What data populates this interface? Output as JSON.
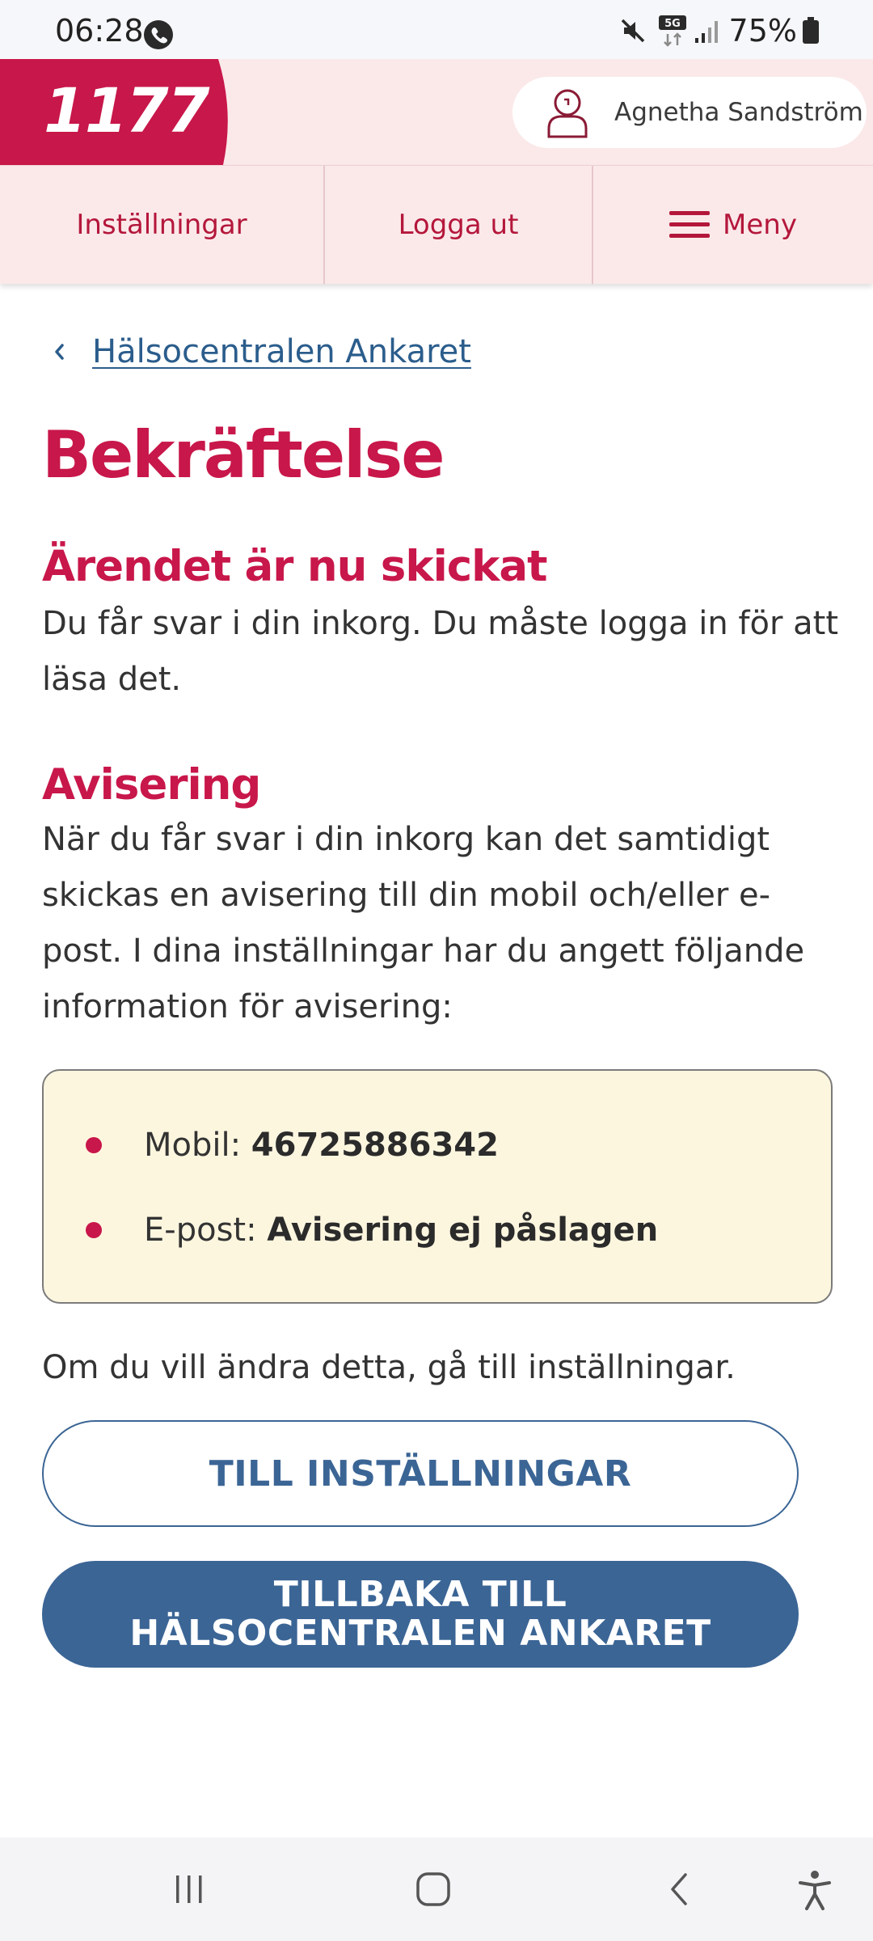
{
  "status_bar": {
    "time": "06:28",
    "network": "5G",
    "battery": "75%"
  },
  "header": {
    "logo_text": "1177",
    "user_name": "Agnetha Sandström"
  },
  "nav": {
    "settings": "Inställningar",
    "logout": "Logga ut",
    "menu": "Meny"
  },
  "breadcrumb": {
    "label": "Hälsocentralen Ankaret"
  },
  "page": {
    "title": "Bekräftelse",
    "sent_heading": "Ärendet är nu skickat",
    "sent_text": "Du får svar i din inkorg. Du måste logga in för att läsa det.",
    "notification_heading": "Avisering",
    "notification_text": "När du får svar i din inkorg kan det samtidigt skickas en avisering till din mobil och/eller e-post. I dina inställningar har du angett följande information för avisering:",
    "change_text": "Om du vill ändra detta, gå till inställningar."
  },
  "notification_info": {
    "mobile_label": "Mobil: ",
    "mobile_value": "46725886342",
    "email_label": "E-post: ",
    "email_value": "Avisering ej påslagen"
  },
  "buttons": {
    "to_settings": "TILL INSTÄLLNINGAR",
    "back": "TILLBAKA TILL HÄLSOCENTRALEN ANKARET"
  },
  "icons": {
    "call": "phone-call-icon",
    "mute": "mute-icon",
    "signal": "signal-icon",
    "battery": "battery-icon",
    "avatar": "user-avatar-icon",
    "menu": "hamburger-icon",
    "back_chevron": "chevron-left-icon"
  },
  "colors": {
    "brand_red": "#c8174a",
    "header_bg": "#fbe9ea",
    "link_blue": "#2b5d8c",
    "button_blue": "#3b6595",
    "info_bg": "#fdf6df"
  }
}
